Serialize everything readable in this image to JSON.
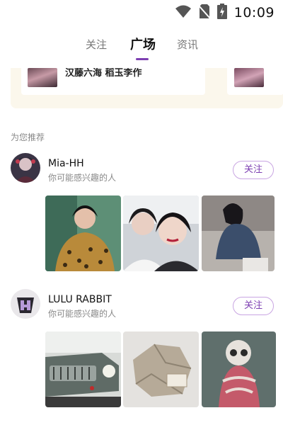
{
  "status_bar": {
    "time": "10:09",
    "icons": [
      "wifi-icon",
      "no-sim-icon",
      "battery-charging-icon"
    ]
  },
  "tabs": [
    {
      "label": "关注",
      "active": false
    },
    {
      "label": "广场",
      "active": true
    },
    {
      "label": "资讯",
      "active": false
    }
  ],
  "promo": {
    "card_title": "汉藤六海 稻玉李作"
  },
  "recommend": {
    "section_label": "为您推荐",
    "users": [
      {
        "name": "Mia-HH",
        "subtitle": "你可能感兴趣的人",
        "follow_label": "关注",
        "photos": [
          "portrait-leopard-coat",
          "two-women-selfie",
          "woman-denim-shirt"
        ]
      },
      {
        "name": "LULU RABBIT",
        "subtitle": "你可能感兴趣的人",
        "follow_label": "关注",
        "photos": [
          "vintage-car",
          "stone-sculpture",
          "robot-figure"
        ]
      }
    ]
  },
  "colors": {
    "accent": "#7d3fb2",
    "follow_border": "#c9a6e2",
    "promo_bg": "#fbf7ec"
  }
}
